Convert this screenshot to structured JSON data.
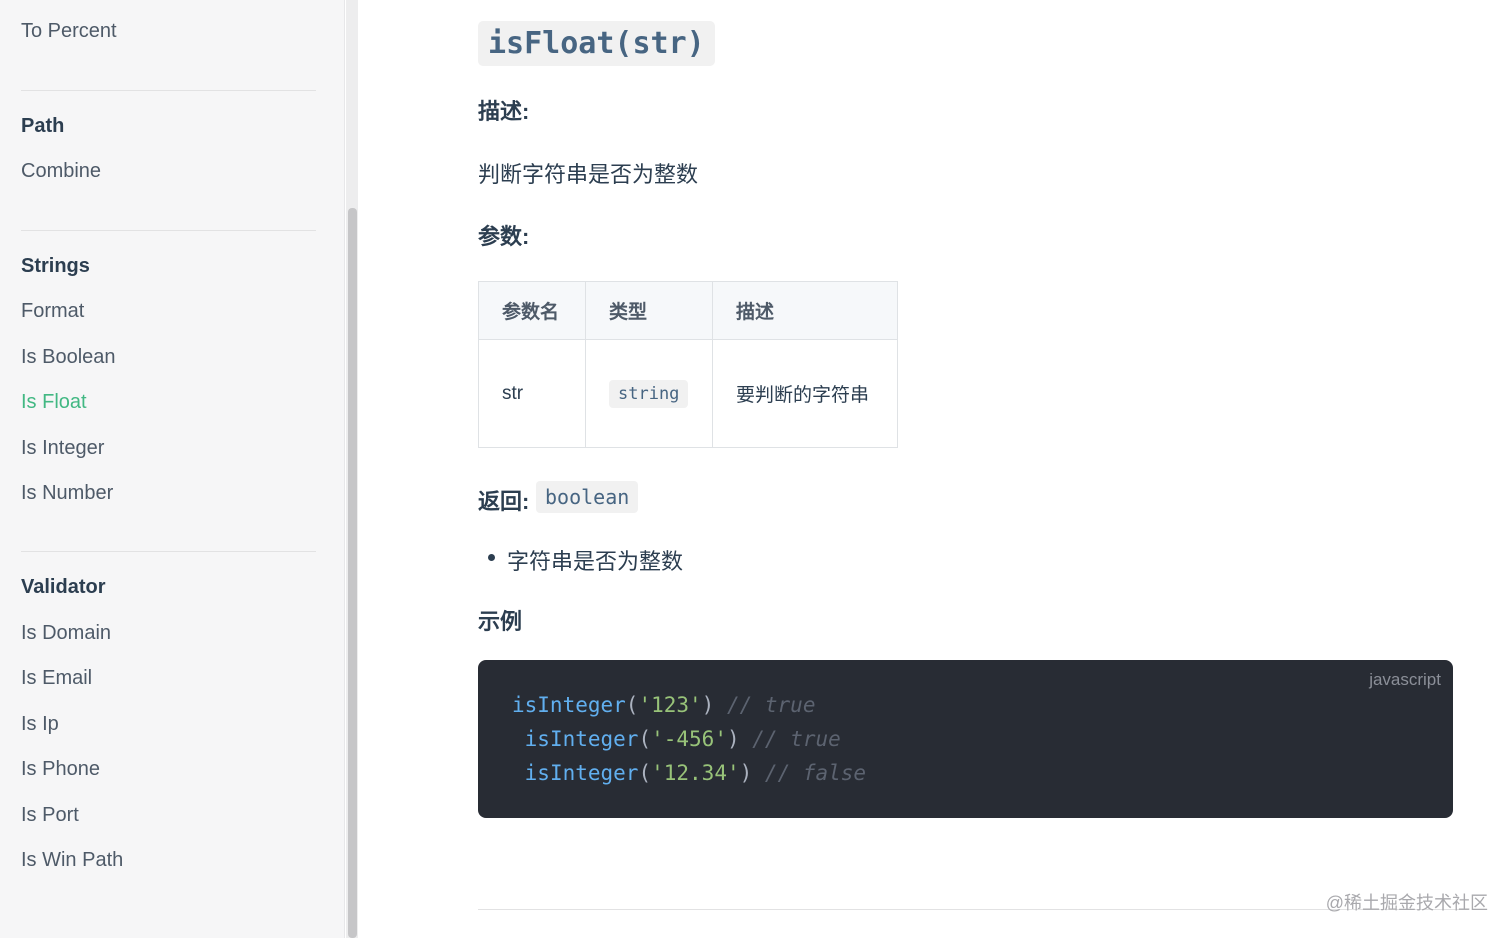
{
  "sidebar": {
    "items": [
      {
        "label": "To Percent"
      },
      {
        "label": "Path",
        "heading": true
      },
      {
        "label": "Combine"
      },
      {
        "label": "Strings",
        "heading": true
      },
      {
        "label": "Format"
      },
      {
        "label": "Is Boolean"
      },
      {
        "label": "Is Float",
        "active": true
      },
      {
        "label": "Is Integer"
      },
      {
        "label": "Is Number"
      },
      {
        "label": "Validator",
        "heading": true
      },
      {
        "label": "Is Domain"
      },
      {
        "label": "Is Email"
      },
      {
        "label": "Is Ip"
      },
      {
        "label": "Is Phone"
      },
      {
        "label": "Is Port"
      },
      {
        "label": "Is Win Path"
      }
    ],
    "active_color": "#42b883"
  },
  "doc": {
    "title": "isFloat(str)",
    "description_label": "描述:",
    "description": "判断字符串是否为整数",
    "params_label": "参数:",
    "params_table": {
      "headers": [
        "参数名",
        "类型",
        "描述"
      ],
      "rows": [
        {
          "name": "str",
          "type": "string",
          "desc": "要判断的字符串"
        }
      ]
    },
    "return_label": "返回:",
    "return_type": "boolean",
    "return_items": [
      "字符串是否为整数"
    ],
    "example_label": "示例",
    "code": {
      "language": "javascript",
      "lines": [
        {
          "indent": "",
          "fn": "isInteger",
          "arg": "'123'",
          "comment": "// true"
        },
        {
          "indent": " ",
          "fn": "isInteger",
          "arg": "'-456'",
          "comment": "// true"
        },
        {
          "indent": " ",
          "fn": "isInteger",
          "arg": "'12.34'",
          "comment": "// false"
        }
      ]
    }
  },
  "watermark": "@稀土掘金技术社区"
}
